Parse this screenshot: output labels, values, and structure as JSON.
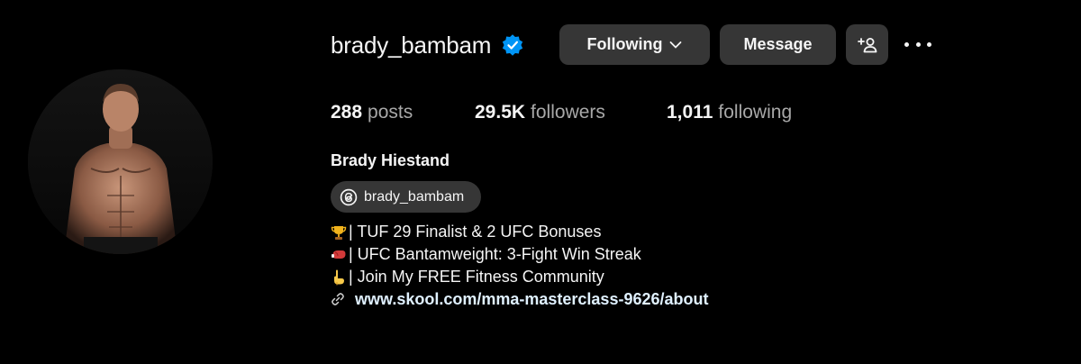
{
  "profile": {
    "username": "brady_bambam",
    "verified": true,
    "full_name": "Brady Hiestand",
    "threads_handle": "brady_bambam",
    "avatar_icon": "profile-photo"
  },
  "actions": {
    "following_label": "Following",
    "message_label": "Message",
    "add_user_icon": "add-person-icon",
    "more_icon": "more-options-icon"
  },
  "stats": {
    "posts_count": "288",
    "posts_label": "posts",
    "followers_count": "29.5K",
    "followers_label": "followers",
    "following_count": "1,011",
    "following_label": "following"
  },
  "bio": {
    "lines": [
      {
        "icon": "trophy-emoji",
        "text": "| TUF 29 Finalist & 2 UFC Bonuses"
      },
      {
        "icon": "boxing-glove-emoji",
        "text": "| UFC Bantamweight: 3-Fight Win Streak"
      },
      {
        "icon": "pointing-down-emoji",
        "text": "| Join My FREE Fitness Community"
      }
    ],
    "link": "www.skool.com/mma-masterclass-9626/about"
  },
  "colors": {
    "background": "#000000",
    "button": "#363636",
    "verified_badge": "#0095f6",
    "secondary_text": "#a8a8a8",
    "link_text": "#e0f1ff"
  }
}
